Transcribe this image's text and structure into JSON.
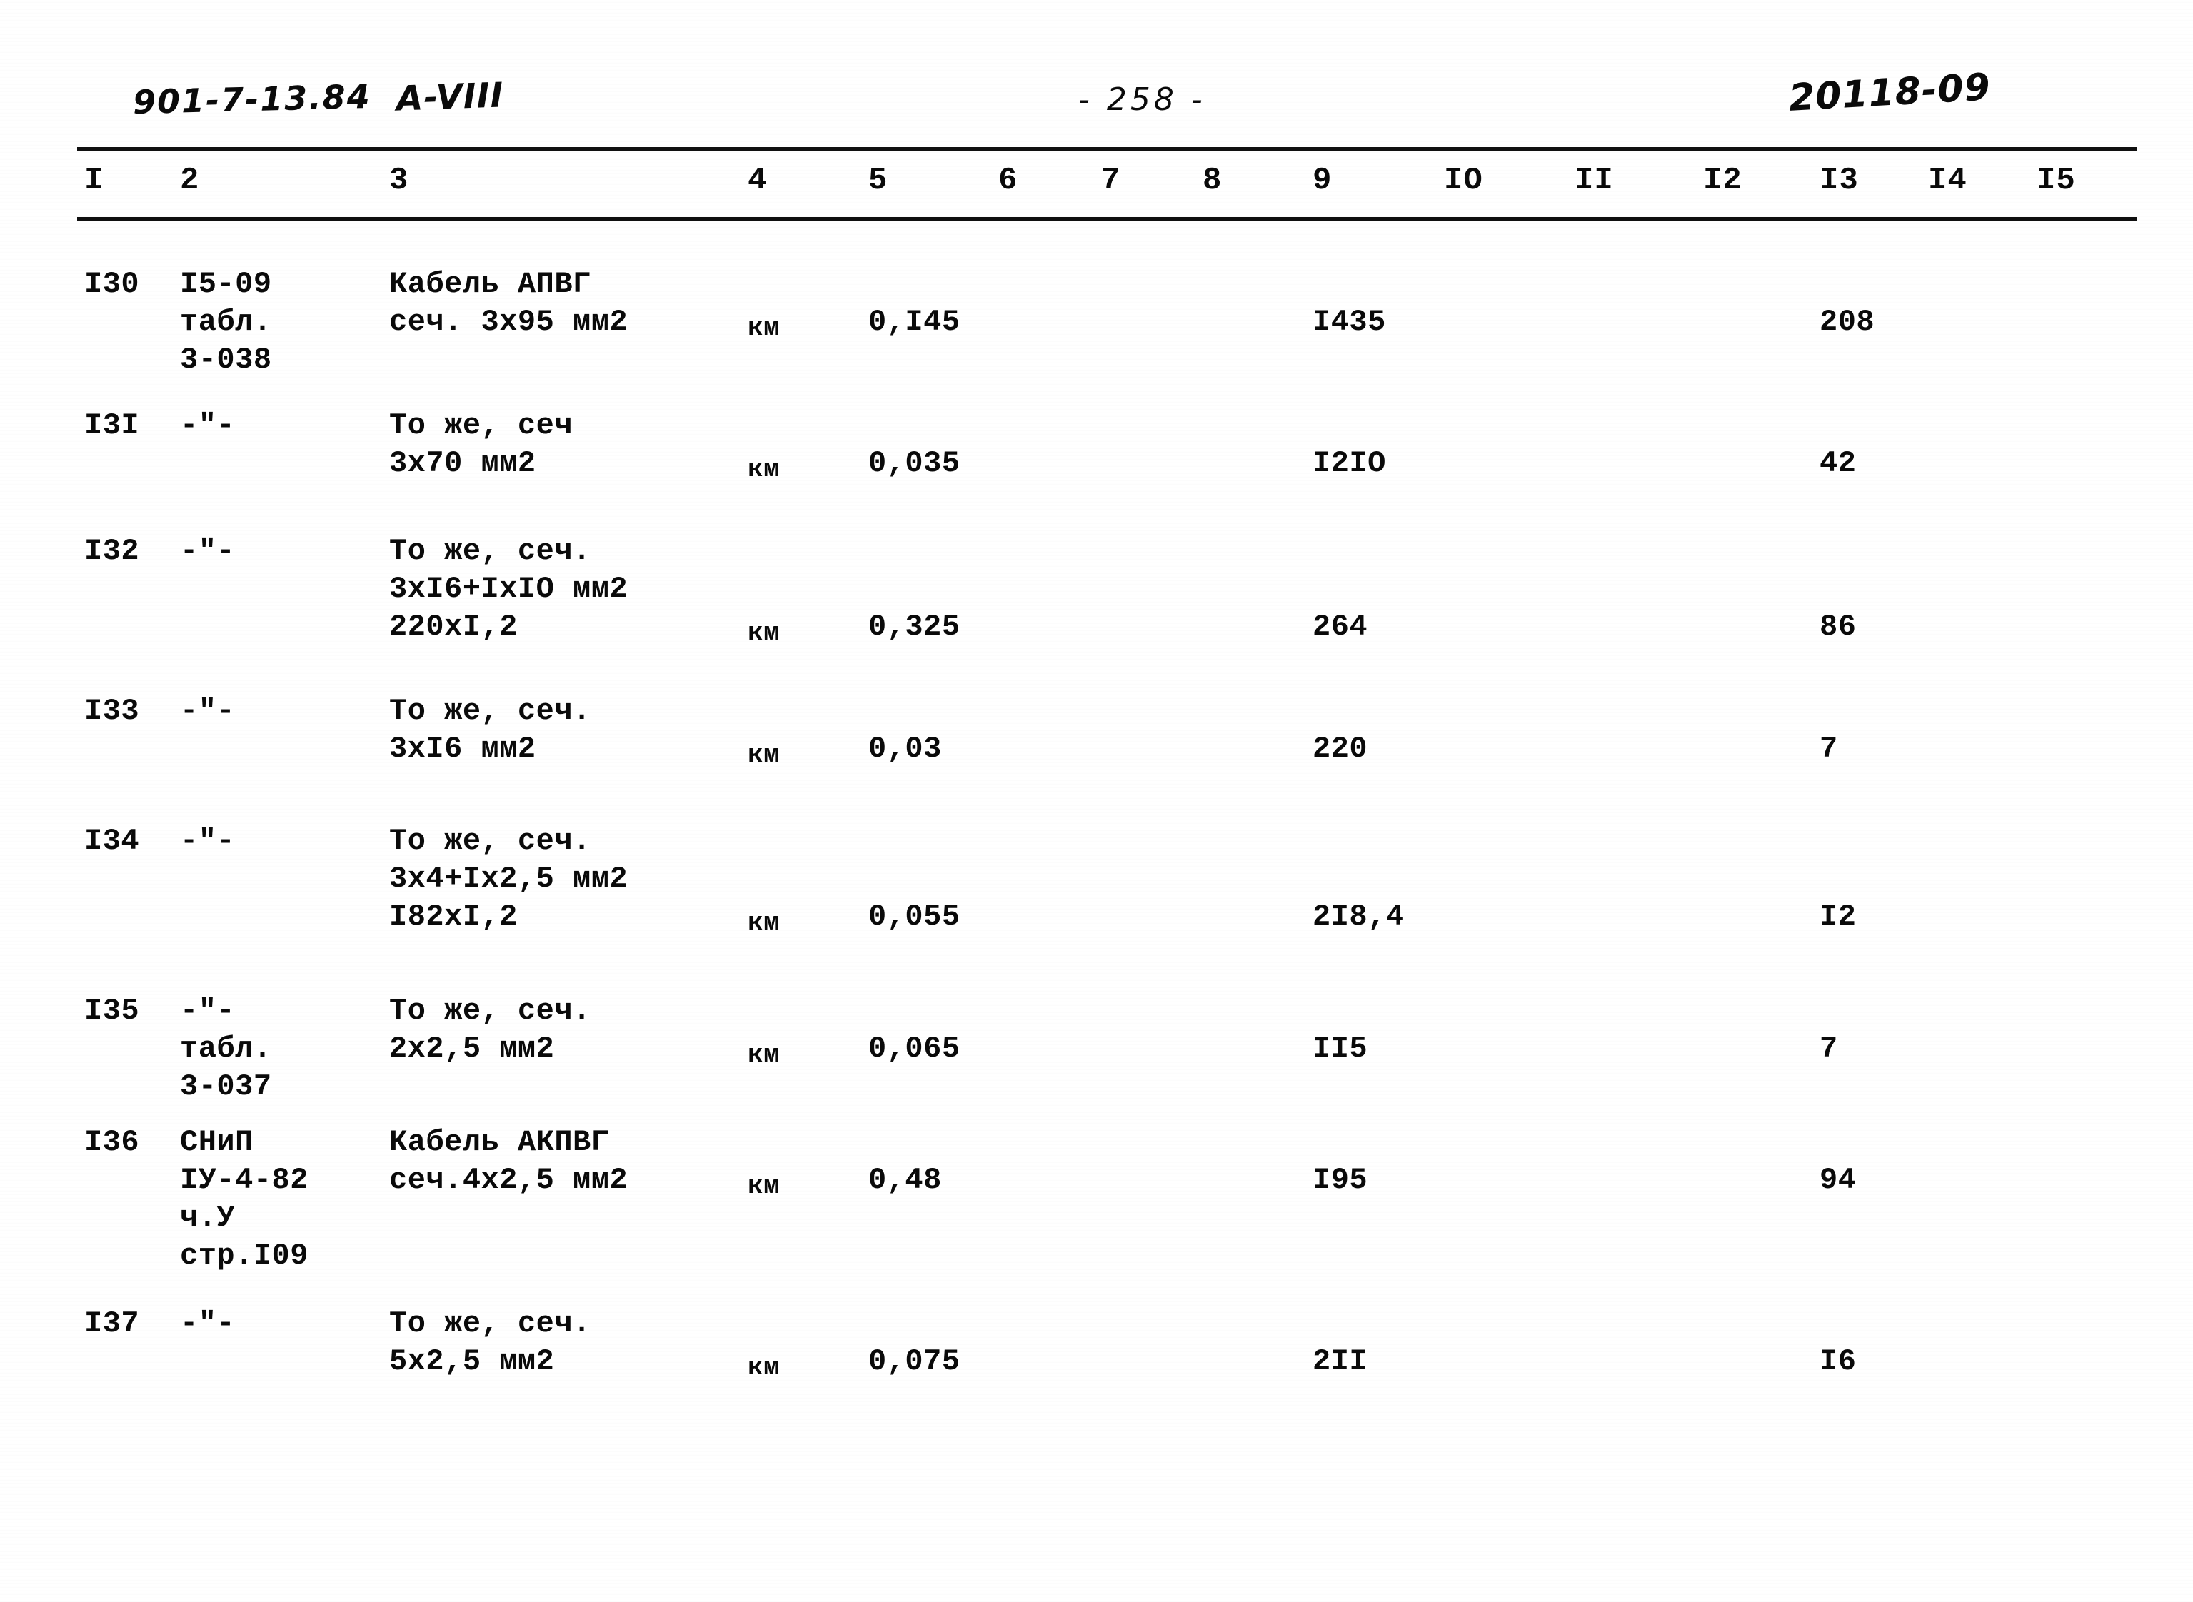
{
  "header": {
    "doc_code": "901-7-13.84",
    "variant": "A-VIII",
    "page_number": "- 258 -",
    "right_code": "20118-09"
  },
  "table": {
    "column_numbers": [
      "I",
      "2",
      "3",
      "4",
      "5",
      "6",
      "7",
      "8",
      "9",
      "IO",
      "II",
      "I2",
      "I3",
      "I4",
      "I5"
    ],
    "rows": [
      {
        "c1": "I30",
        "c2": "I5-09\nтабл.\n3-038",
        "c3": "Кабель АПВГ\nсеч. 3х95 мм2",
        "c4": "км",
        "c5": "0,I45",
        "c9": "I435",
        "c13": "208"
      },
      {
        "c1": "I3I",
        "c2": "-\"-",
        "c3": "То же, сеч\n3х70 мм2",
        "c4": "км",
        "c5": "0,035",
        "c9": "I2IO",
        "c13": "42"
      },
      {
        "c1": "I32",
        "c2": "-\"-",
        "c3": "То же, сеч.\n3хI6+IхIO мм2\n220хI,2",
        "c4": "км",
        "c5": "0,325",
        "c9": "264",
        "c13": "86"
      },
      {
        "c1": "I33",
        "c2": "-\"-",
        "c3": "То же, сеч.\n3хI6 мм2",
        "c4": "км",
        "c5": "0,03",
        "c9": "220",
        "c13": "7"
      },
      {
        "c1": "I34",
        "c2": "-\"-",
        "c3": "То же, сеч.\n3х4+Iх2,5 мм2\nI82хI,2",
        "c4": "км",
        "c5": "0,055",
        "c9": "2I8,4",
        "c13": "I2"
      },
      {
        "c1": "I35",
        "c2": "-\"-\nтабл.\n3-037",
        "c3": "То же, сеч.\n2х2,5 мм2",
        "c4": "км",
        "c5": "0,065",
        "c9": "II5",
        "c13": "7"
      },
      {
        "c1": "I36",
        "c2": "СНиП\nIУ-4-82\nч.У\nстр.I09",
        "c3": "Кабель АКПВГ\nсеч.4х2,5 мм2",
        "c4": "км",
        "c5": "0,48",
        "c9": "I95",
        "c13": "94"
      },
      {
        "c1": "I37",
        "c2": "-\"-",
        "c3": "То же, сеч.\n5х2,5 мм2",
        "c4": "км",
        "c5": "0,075",
        "c9": "2II",
        "c13": "I6"
      }
    ]
  }
}
